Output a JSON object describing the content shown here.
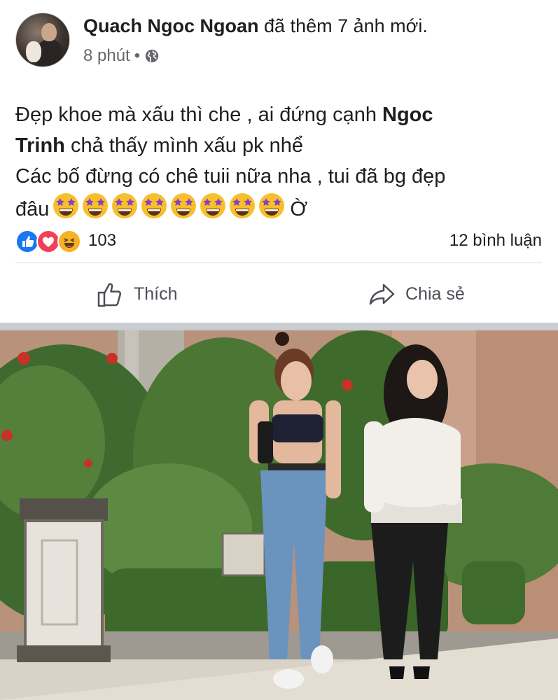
{
  "post": {
    "author": "Quach Ngoc Ngoan",
    "action_text": "đã thêm 7 ảnh mới.",
    "time": "8 phút",
    "separator": "•",
    "privacy_icon": "globe-icon",
    "text_line1_a": "Đẹp khoe mà xấu thì che , ai đứng cạnh ",
    "text_line1_bold": "Ngoc",
    "text_line2_bold": "Trinh",
    "text_line2_b": " chả thấy mình xấu pk nhể",
    "text_line3": "Các bố đừng có chê tuii nữa nha , tui đã bg đẹp",
    "text_line4_a": "đâu",
    "text_line4_b": "Ờ",
    "emoji_name": "star-struck-emoji",
    "emoji_count": 8
  },
  "reactions": {
    "icons": [
      "like-icon",
      "love-icon",
      "haha-icon"
    ],
    "count": "103",
    "comments": "12 bình luận"
  },
  "actions": {
    "like_label": "Thích",
    "share_label": "Chia sẻ"
  },
  "colors": {
    "like_blue": "#1877f2",
    "love_red": "#f33e58",
    "haha_yellow": "#f7b125",
    "text_gray": "#65676b"
  }
}
